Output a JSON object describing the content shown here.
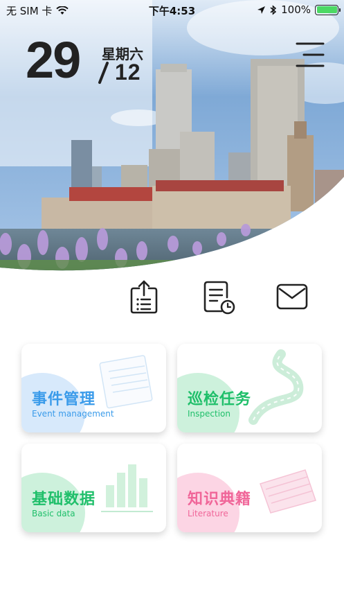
{
  "status_bar": {
    "carrier": "无 SIM 卡",
    "time": "下午4:53",
    "battery": "100%",
    "battery_level": 1.0
  },
  "date": {
    "day": "29",
    "weekday": "星期六",
    "month": "12"
  },
  "quick_actions": [
    {
      "icon": "upload-icon"
    },
    {
      "icon": "document-clock-icon"
    },
    {
      "icon": "mail-icon"
    }
  ],
  "cards": {
    "event": {
      "title": "事件管理",
      "subtitle": "Event management",
      "color": "#3a9bea",
      "blob_color": "#cfe6fb"
    },
    "inspection": {
      "title": "巡检任务",
      "subtitle": "Inspection",
      "color": "#1fbf6a",
      "blob_color": "#c9f0d9"
    },
    "basic": {
      "title": "基础数据",
      "subtitle": "Basic data",
      "color": "#1fbf6a",
      "blob_color": "#c9f0d9"
    },
    "literature": {
      "title": "知识典籍",
      "subtitle": "Literature",
      "color": "#f06699",
      "blob_color": "#fbd3e2"
    }
  }
}
